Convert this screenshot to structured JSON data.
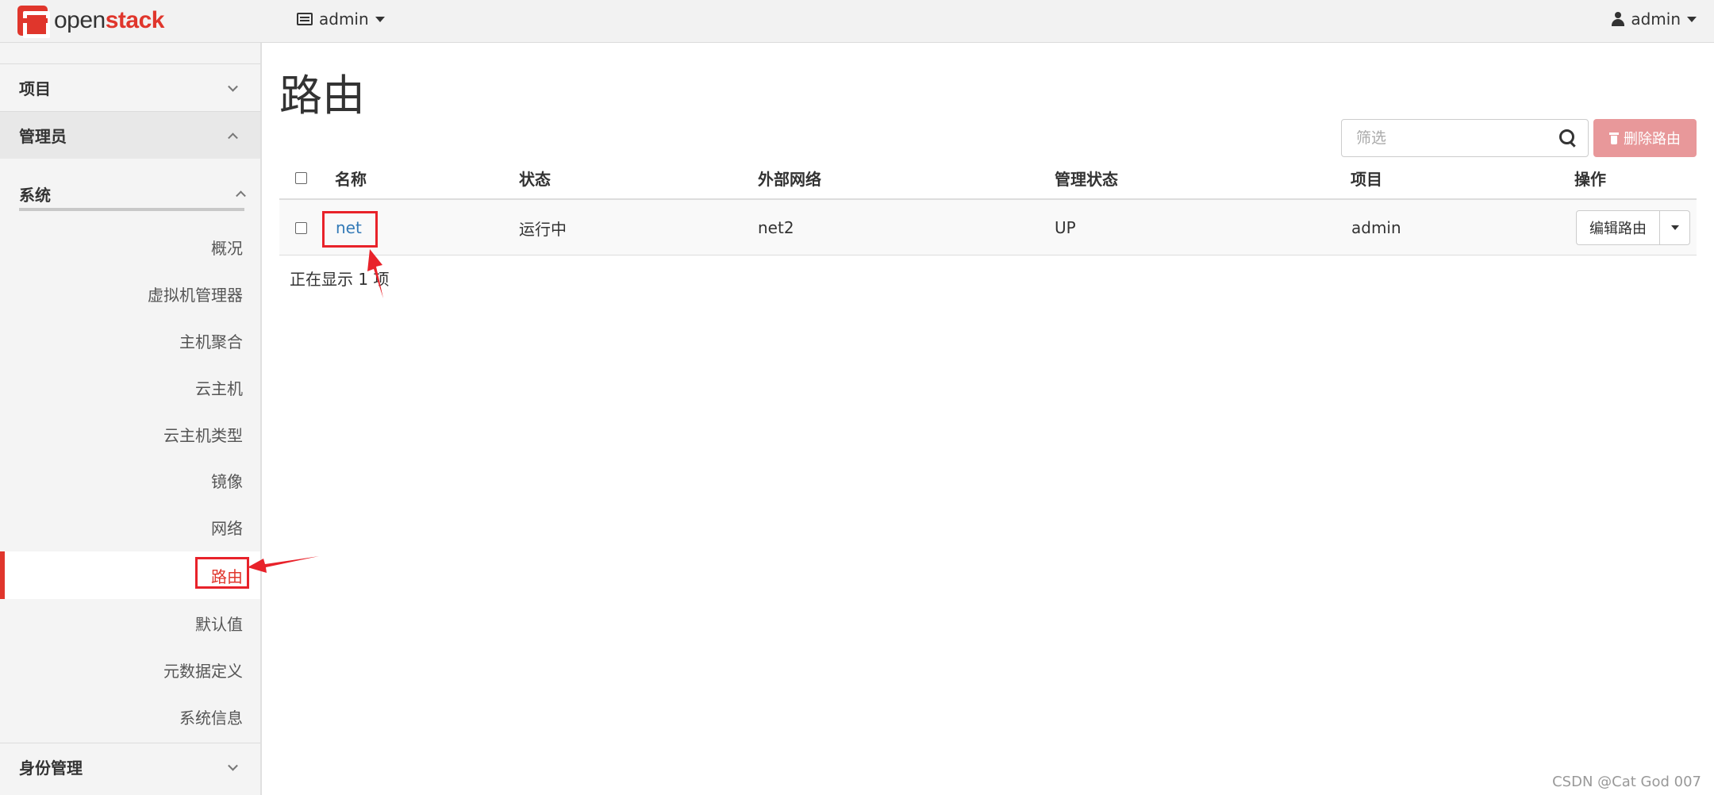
{
  "topbar": {
    "logo_text_plain": "open",
    "logo_text_accent": "stack",
    "project_switcher": "admin",
    "user_menu": "admin"
  },
  "sidebar": {
    "groups": {
      "project": "项目",
      "admin": "管理员",
      "identity": "身份管理"
    },
    "system_label": "系统",
    "items": [
      {
        "label": "概况"
      },
      {
        "label": "虚拟机管理器"
      },
      {
        "label": "主机聚合"
      },
      {
        "label": "云主机"
      },
      {
        "label": "云主机类型"
      },
      {
        "label": "镜像"
      },
      {
        "label": "网络"
      },
      {
        "label": "路由",
        "active": true
      },
      {
        "label": "默认值"
      },
      {
        "label": "元数据定义"
      },
      {
        "label": "系统信息"
      }
    ]
  },
  "main": {
    "title": "路由",
    "filter_placeholder": "筛选",
    "delete_button": "删除路由",
    "columns": [
      "名称",
      "状态",
      "外部网络",
      "管理状态",
      "项目",
      "操作"
    ],
    "rows": [
      {
        "name": "net",
        "status": "运行中",
        "external_network": "net2",
        "admin_state": "UP",
        "project": "admin",
        "action": "编辑路由"
      }
    ],
    "count_text": "正在显示 1 项"
  },
  "watermark": "CSDN @Cat God 007",
  "colors": {
    "brand_red": "#e0362c",
    "link_blue": "#337ab7",
    "danger_disabled": "#e8989a",
    "annotation_red": "#e8222a"
  }
}
